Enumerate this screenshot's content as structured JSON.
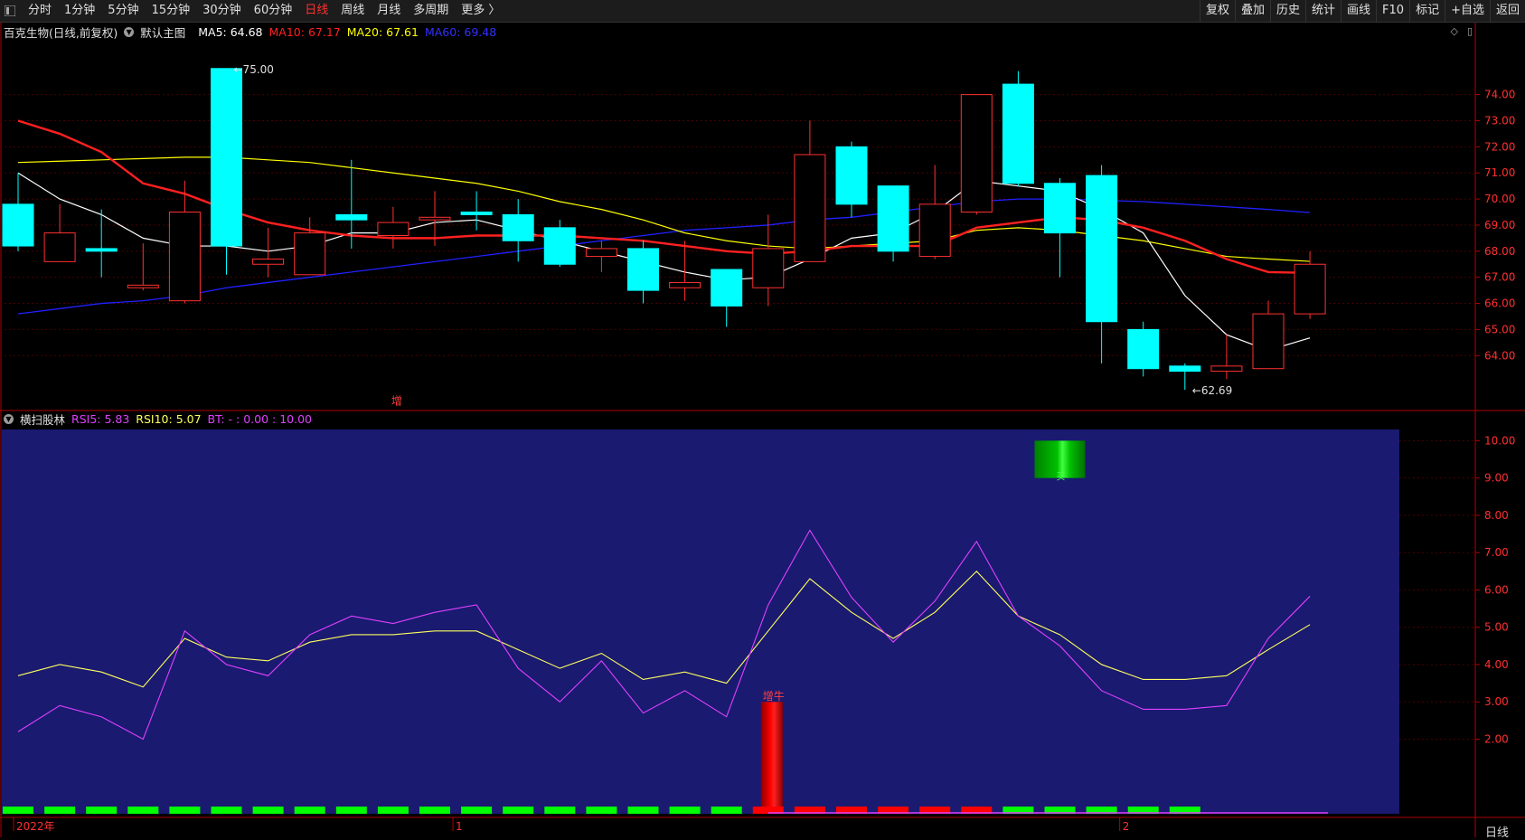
{
  "toolbar": {
    "periods": [
      "分时",
      "1分钟",
      "5分钟",
      "15分钟",
      "30分钟",
      "60分钟",
      "日线",
      "周线",
      "月线",
      "多周期",
      "更多 〉"
    ],
    "active_period": "日线",
    "actions": [
      "复权",
      "叠加",
      "历史",
      "统计",
      "画线",
      "F10",
      "标记",
      "+自选",
      "返回"
    ]
  },
  "main_legend": {
    "stock": "百克生物(日线,前复权)",
    "template": "默认主图",
    "ma5": "MA5: 64.68",
    "ma10": "MA10: 67.17",
    "ma20": "MA20: 67.61",
    "ma60": "MA60: 69.48"
  },
  "sub_legend": {
    "indicator": "横扫股林",
    "rsi5": "RSI5: 5.83",
    "rsi10": "RSI10: 5.07",
    "bt": "BT: - : 0.00 : 10.00"
  },
  "corner_icons": [
    "diamond-icon",
    "window-icon"
  ],
  "period_label": "日线",
  "colors": {
    "up": "#ff3030",
    "down": "#00ffff",
    "ma5": "#ffffff",
    "ma10": "#ff2020",
    "ma20": "#ffff00",
    "ma60": "#2020ff",
    "rsi5": "#e040ff",
    "rsi10": "#ffff60",
    "sub_bg": "#1a1a70",
    "axis": "#b00000"
  },
  "chart_data": [
    {
      "type": "candlestick",
      "ylim": [
        62.0,
        75.2
      ],
      "yticks": [
        "64.00",
        "65.00",
        "66.00",
        "67.00",
        "68.00",
        "69.00",
        "70.00",
        "71.00",
        "72.00",
        "73.00",
        "74.00"
      ],
      "candles": [
        {
          "o": 69.8,
          "c": 68.2,
          "h": 71.0,
          "l": 68.0
        },
        {
          "o": 67.6,
          "c": 68.7,
          "h": 69.8,
          "l": 67.6
        },
        {
          "o": 68.1,
          "c": 68.0,
          "h": 69.6,
          "l": 67.0
        },
        {
          "o": 66.6,
          "c": 66.7,
          "h": 68.3,
          "l": 66.5
        },
        {
          "o": 66.1,
          "c": 69.5,
          "h": 70.7,
          "l": 66.0
        },
        {
          "o": 75.0,
          "c": 68.2,
          "h": 75.0,
          "l": 67.1
        },
        {
          "o": 67.5,
          "c": 67.7,
          "h": 68.9,
          "l": 67.0
        },
        {
          "o": 67.1,
          "c": 68.7,
          "h": 69.3,
          "l": 67.1
        },
        {
          "o": 69.4,
          "c": 69.2,
          "h": 71.5,
          "l": 68.1
        },
        {
          "o": 68.6,
          "c": 69.1,
          "h": 69.7,
          "l": 68.1
        },
        {
          "o": 69.2,
          "c": 69.3,
          "h": 70.3,
          "l": 68.2
        },
        {
          "o": 69.5,
          "c": 69.4,
          "h": 70.3,
          "l": 68.8
        },
        {
          "o": 69.4,
          "c": 68.4,
          "h": 70.0,
          "l": 67.6
        },
        {
          "o": 68.9,
          "c": 67.5,
          "h": 69.2,
          "l": 67.4
        },
        {
          "o": 67.8,
          "c": 68.1,
          "h": 68.4,
          "l": 67.2
        },
        {
          "o": 68.1,
          "c": 66.5,
          "h": 68.4,
          "l": 66.0
        },
        {
          "o": 66.6,
          "c": 66.8,
          "h": 68.4,
          "l": 66.1
        },
        {
          "o": 67.3,
          "c": 65.9,
          "h": 67.3,
          "l": 65.1
        },
        {
          "o": 66.6,
          "c": 68.1,
          "h": 69.4,
          "l": 65.9
        },
        {
          "o": 67.6,
          "c": 71.7,
          "h": 73.0,
          "l": 67.6
        },
        {
          "o": 72.0,
          "c": 69.8,
          "h": 72.2,
          "l": 69.3
        },
        {
          "o": 70.5,
          "c": 68.0,
          "h": 70.5,
          "l": 67.6
        },
        {
          "o": 67.8,
          "c": 69.8,
          "h": 71.3,
          "l": 67.7
        },
        {
          "o": 69.5,
          "c": 74.0,
          "h": 74.0,
          "l": 69.4
        },
        {
          "o": 74.4,
          "c": 70.6,
          "h": 74.9,
          "l": 70.5
        },
        {
          "o": 70.6,
          "c": 68.7,
          "h": 70.8,
          "l": 67.0
        },
        {
          "o": 70.9,
          "c": 65.3,
          "h": 71.3,
          "l": 63.7
        },
        {
          "o": 65.0,
          "c": 63.5,
          "h": 65.3,
          "l": 63.2
        },
        {
          "o": 63.6,
          "c": 63.4,
          "h": 63.7,
          "l": 62.69
        },
        {
          "o": 63.4,
          "c": 63.6,
          "h": 64.8,
          "l": 63.1
        },
        {
          "o": 63.5,
          "c": 65.6,
          "h": 66.1,
          "l": 63.5
        },
        {
          "o": 65.6,
          "c": 67.5,
          "h": 68.0,
          "l": 65.4
        }
      ],
      "ma5": [
        71.0,
        70.0,
        69.4,
        68.5,
        68.2,
        68.2,
        68.0,
        68.2,
        68.7,
        68.7,
        69.1,
        69.2,
        68.8,
        68.4,
        68.0,
        67.6,
        67.2,
        66.9,
        67.0,
        67.7,
        68.5,
        68.7,
        69.5,
        70.7,
        70.5,
        70.3,
        69.6,
        68.7,
        66.3,
        64.8,
        64.2,
        64.68
      ],
      "ma10": [
        73.0,
        72.5,
        71.8,
        70.6,
        70.2,
        69.6,
        69.1,
        68.8,
        68.6,
        68.5,
        68.5,
        68.6,
        68.6,
        68.6,
        68.5,
        68.4,
        68.2,
        68.0,
        67.9,
        68.0,
        68.2,
        68.2,
        68.2,
        68.9,
        69.1,
        69.3,
        69.2,
        68.9,
        68.4,
        67.7,
        67.2,
        67.17
      ],
      "ma20": [
        71.4,
        71.45,
        71.5,
        71.55,
        71.6,
        71.6,
        71.5,
        71.4,
        71.2,
        71.0,
        70.8,
        70.6,
        70.3,
        69.9,
        69.6,
        69.2,
        68.7,
        68.4,
        68.2,
        68.1,
        68.2,
        68.3,
        68.4,
        68.8,
        68.9,
        68.8,
        68.6,
        68.4,
        68.1,
        67.8,
        67.7,
        67.61
      ],
      "ma60": [
        65.6,
        65.8,
        66.0,
        66.1,
        66.3,
        66.6,
        66.8,
        67.0,
        67.2,
        67.4,
        67.6,
        67.8,
        68.0,
        68.2,
        68.4,
        68.6,
        68.8,
        68.9,
        69.0,
        69.2,
        69.3,
        69.5,
        69.7,
        69.9,
        70.0,
        70.0,
        69.95,
        69.9,
        69.8,
        69.7,
        69.6,
        69.48
      ],
      "annotations": [
        {
          "text": "75.00",
          "index": 5,
          "value": 75.0
        },
        {
          "text": "62.69",
          "index": 28,
          "value": 62.69
        },
        {
          "text": "增",
          "index": 9,
          "value": 62.4
        }
      ]
    },
    {
      "type": "line",
      "ylim": [
        0,
        10.3
      ],
      "yticks": [
        "2.00",
        "3.00",
        "4.00",
        "5.00",
        "6.00",
        "7.00",
        "8.00",
        "9.00",
        "10.00"
      ],
      "rsi5": [
        2.2,
        2.9,
        2.6,
        2.0,
        4.9,
        4.0,
        3.7,
        4.8,
        5.3,
        5.1,
        5.4,
        5.6,
        3.9,
        3.0,
        4.1,
        2.7,
        3.3,
        2.6,
        5.6,
        7.6,
        5.8,
        4.6,
        5.7,
        7.3,
        5.3,
        4.5,
        3.3,
        2.8,
        2.8,
        2.9,
        4.7,
        5.83
      ],
      "rsi10": [
        3.7,
        4.0,
        3.8,
        3.4,
        4.7,
        4.2,
        4.1,
        4.6,
        4.8,
        4.8,
        4.9,
        4.9,
        4.4,
        3.9,
        4.3,
        3.6,
        3.8,
        3.5,
        4.9,
        6.3,
        5.4,
        4.7,
        5.4,
        6.5,
        5.3,
        4.8,
        4.0,
        3.6,
        3.6,
        3.7,
        4.4,
        5.07
      ],
      "bt_bar": {
        "index": 18,
        "value": 3.0,
        "label": "增牛"
      },
      "top_bar": {
        "index": 25,
        "from": 9.0,
        "to": 10.0,
        "label": "买"
      },
      "bottom_strip": [
        "g",
        "g",
        "g",
        "g",
        "g",
        "g",
        "g",
        "g",
        "g",
        "g",
        "g",
        "g",
        "g",
        "g",
        "g",
        "g",
        "g",
        "g",
        "r",
        "r",
        "r",
        "r",
        "r",
        "r",
        "g",
        "g",
        "g",
        "g",
        "g",
        "",
        ""
      ],
      "xlabels": [
        {
          "text": "2022年",
          "index": 0
        },
        {
          "text": "1",
          "index": 10.5
        },
        {
          "text": "2",
          "index": 26.5
        }
      ]
    }
  ]
}
